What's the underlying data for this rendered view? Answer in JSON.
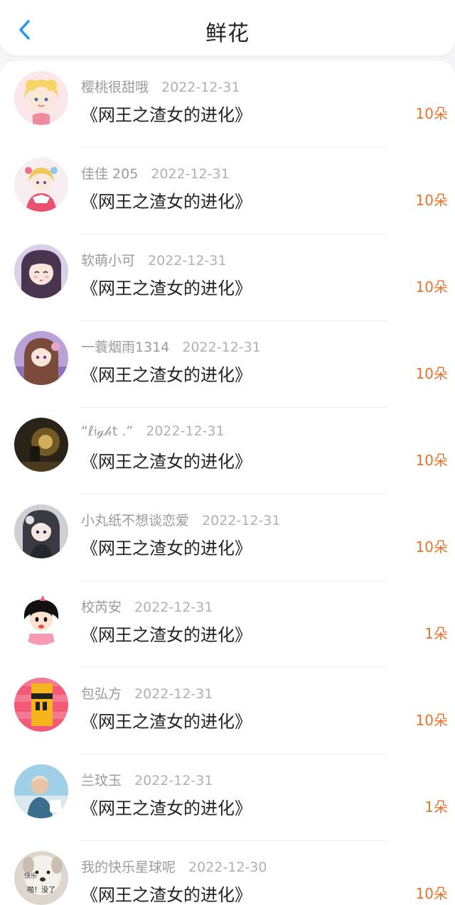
{
  "header": {
    "title": "鲜花",
    "accent": "#2196f3"
  },
  "rows": [
    {
      "name": "樱桃很甜哦",
      "date": "2022-12-31",
      "book": "《网王之渣女的进化》",
      "count": "10朵"
    },
    {
      "name": "佳佳 205",
      "date": "2022-12-31",
      "book": "《网王之渣女的进化》",
      "count": "10朵"
    },
    {
      "name": "软萌小可",
      "date": "2022-12-31",
      "book": "《网王之渣女的进化》",
      "count": "10朵"
    },
    {
      "name": "一蓑烟雨1314",
      "date": "2022-12-31",
      "book": "《网王之渣女的进化》",
      "count": "10朵"
    },
    {
      "name": "“ℓ𝔦ℊ𝒽t .”",
      "date": "2022-12-31",
      "book": "《网王之渣女的进化》",
      "count": "10朵"
    },
    {
      "name": "小丸纸不想谈恋爱",
      "date": "2022-12-31",
      "book": "《网王之渣女的进化》",
      "count": "10朵"
    },
    {
      "name": "校芮安",
      "date": "2022-12-31",
      "book": "《网王之渣女的进化》",
      "count": "1朵"
    },
    {
      "name": "包弘方",
      "date": "2022-12-31",
      "book": "《网王之渣女的进化》",
      "count": "10朵"
    },
    {
      "name": "兰玟玉",
      "date": "2022-12-31",
      "book": "《网王之渣女的进化》",
      "count": "1朵"
    },
    {
      "name": "我的快乐星球呢",
      "date": "2022-12-30",
      "book": "《网王之渣女的进化》",
      "count": "10朵"
    }
  ],
  "avatar_texts": {
    "dog_top": "快乐",
    "dog_bottom": "啪！没了"
  },
  "colors": {
    "count": "#e8742c",
    "name": "#9a9a9a",
    "date": "#b0b0b0"
  }
}
